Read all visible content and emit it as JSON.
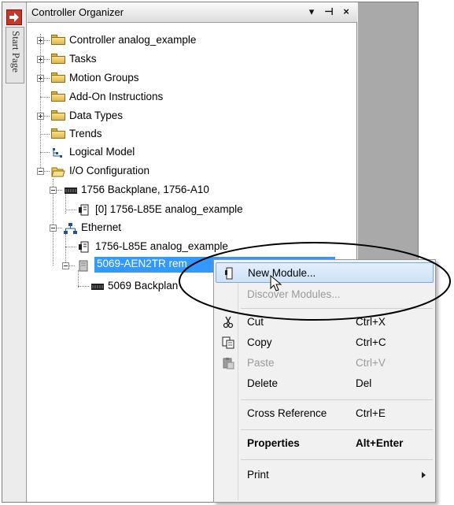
{
  "window": {
    "strip_tab_label": "Start Page",
    "panel_title": "Controller Organizer",
    "title_buttons": [
      "▾",
      "⊣",
      "×"
    ]
  },
  "tree": {
    "items": [
      {
        "label": "Controller analog_example",
        "icon": "folder-icon"
      },
      {
        "label": "Tasks",
        "icon": "folder-icon"
      },
      {
        "label": "Motion Groups",
        "icon": "folder-icon"
      },
      {
        "label": "Add-On Instructions",
        "icon": "folder-icon"
      },
      {
        "label": "Data Types",
        "icon": "folder-icon"
      },
      {
        "label": "Trends",
        "icon": "folder-icon"
      },
      {
        "label": "Logical Model",
        "icon": "logical-model-icon"
      },
      {
        "label": "I/O Configuration",
        "icon": "open-folder-icon"
      },
      {
        "label": "1756 Backplane, 1756-A10",
        "icon": "backplane-icon"
      },
      {
        "label": "[0] 1756-L85E analog_example",
        "icon": "controller-module-icon"
      },
      {
        "label": "Ethernet",
        "icon": "network-icon"
      },
      {
        "label": "1756-L85E analog_example",
        "icon": "controller-module-icon"
      },
      {
        "label": "5069-AEN2TR rem",
        "icon": "adapter-module-icon"
      },
      {
        "label": "5069 Backplan",
        "icon": "backplane-icon"
      }
    ]
  },
  "context_menu": {
    "items": [
      {
        "label": "New Module...",
        "shortcut": ""
      },
      {
        "label": "Discover Modules...",
        "shortcut": ""
      },
      {
        "label": "Cut",
        "shortcut": "Ctrl+X"
      },
      {
        "label": "Copy",
        "shortcut": "Ctrl+C"
      },
      {
        "label": "Paste",
        "shortcut": "Ctrl+V"
      },
      {
        "label": "Delete",
        "shortcut": "Del"
      },
      {
        "label": "Cross Reference",
        "shortcut": "Ctrl+E"
      },
      {
        "label": "Properties",
        "shortcut": "Alt+Enter"
      },
      {
        "label": "Print",
        "shortcut": ""
      }
    ]
  },
  "colors": {
    "selection": "#3399ff",
    "menu_highlight": "#cfe2f8",
    "folder": "#e1b94a"
  }
}
